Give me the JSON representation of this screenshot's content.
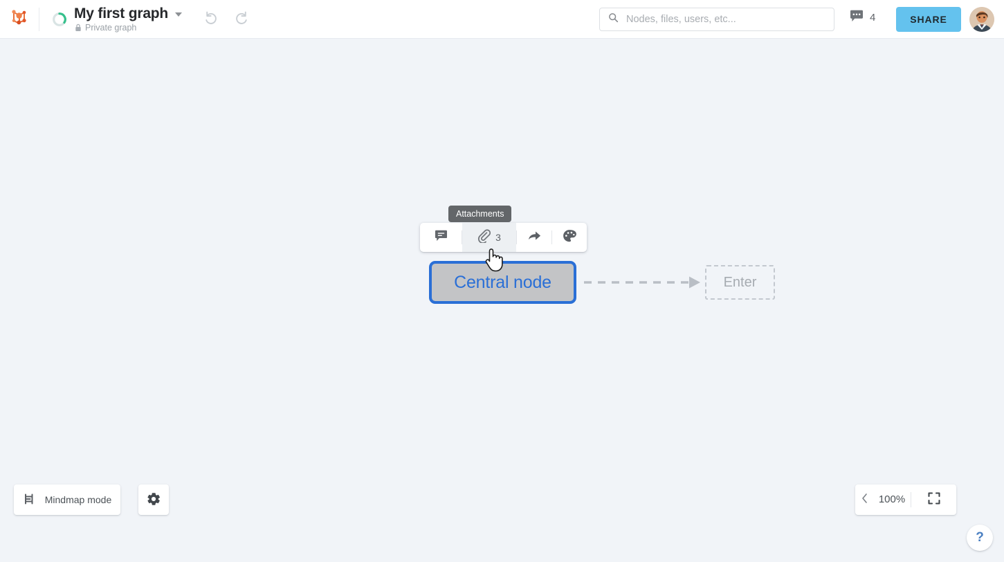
{
  "header": {
    "logo_icon": "graph-nodes-logo",
    "progress_ring_icon": "progress-ring-icon",
    "graph_title": "My first graph",
    "title_caret_icon": "chevron-down-icon",
    "lock_icon": "lock-icon",
    "privacy_label": "Private graph",
    "undo_icon": "undo-icon",
    "redo_icon": "redo-icon",
    "search": {
      "icon": "search-icon",
      "placeholder": "Nodes, files, users, etc...",
      "value": ""
    },
    "comments": {
      "icon": "comment-bubble-icon",
      "count": "4"
    },
    "share_label": "SHARE",
    "avatar_icon": "user-avatar"
  },
  "canvas": {
    "tooltip": {
      "text": "Attachments"
    },
    "node_toolbar": {
      "items": [
        {
          "name": "comment",
          "icon": "comment-icon",
          "label": ""
        },
        {
          "name": "attachments",
          "icon": "paperclip-icon",
          "label": "3"
        },
        {
          "name": "share",
          "icon": "share-arrow-icon",
          "label": ""
        },
        {
          "name": "color",
          "icon": "palette-icon",
          "label": ""
        }
      ]
    },
    "central_node": {
      "label": "Central node",
      "border_color": "#2a6fd6",
      "fill_color": "#c3c4c6",
      "text_color": "#2a6fd6"
    },
    "connector": {
      "style": "dashed",
      "color": "#b9bec5",
      "arrow_icon": "arrow-right-icon"
    },
    "new_node_placeholder": {
      "label": "Enter",
      "border_color": "#c3c8cf",
      "text_color": "#a6abb1"
    },
    "cursor_icon": "pointer-hand-cursor",
    "background_color": "#f1f4f8"
  },
  "bottom_bar": {
    "mindmap": {
      "icon": "mindmap-branch-icon",
      "label": "Mindmap mode"
    },
    "settings": {
      "icon": "gear-icon"
    },
    "zoom": {
      "prev_icon": "chevron-left-icon",
      "level": "100%",
      "fit_icon": "fit-screen-icon"
    },
    "help": {
      "label": "?"
    }
  }
}
